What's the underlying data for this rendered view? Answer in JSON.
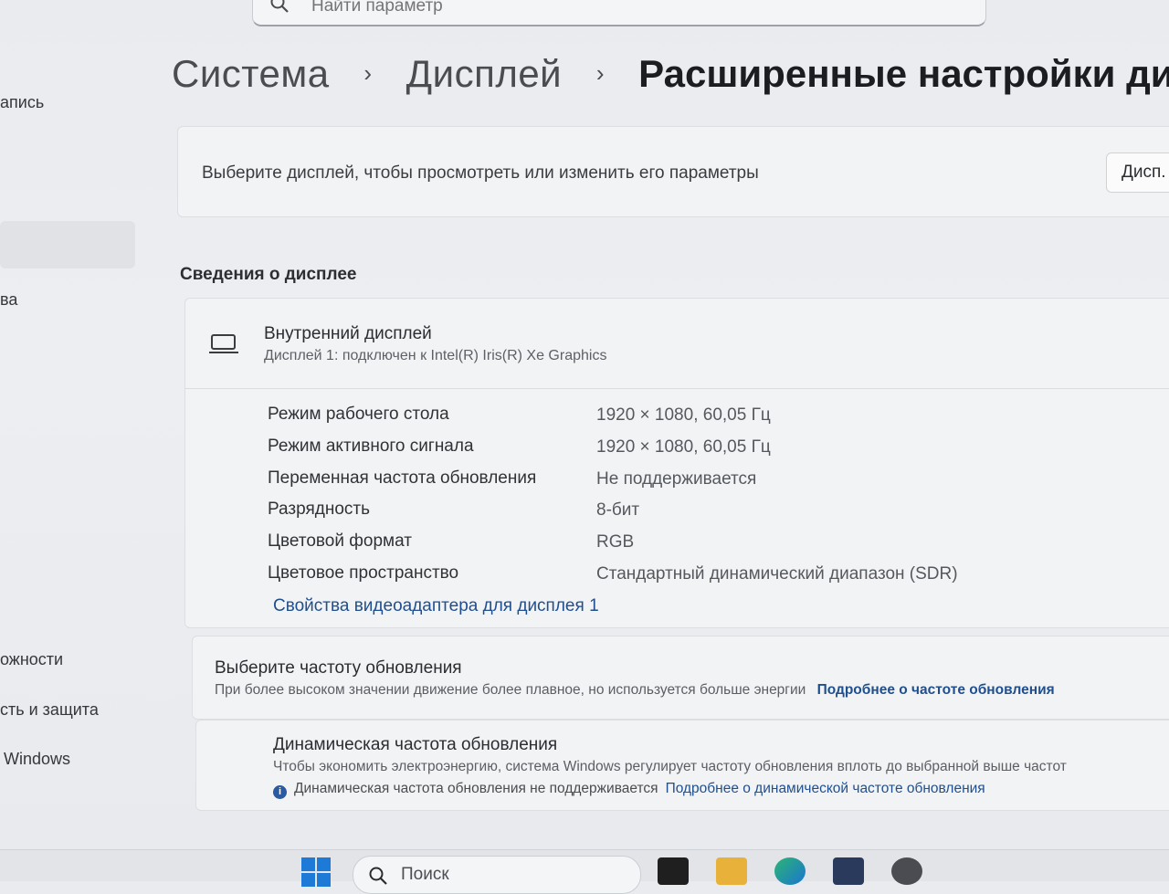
{
  "search": {
    "placeholder": "Найти параметр"
  },
  "sidebar": {
    "items": [
      {
        "label": "апись"
      },
      {
        "label": "ва"
      },
      {
        "label": "ожности"
      },
      {
        "label": "сть и защита"
      },
      {
        "label": "Windows"
      }
    ]
  },
  "breadcrumb": {
    "root": "Система",
    "parent": "Дисплей",
    "current": "Расширенные настройки дисп"
  },
  "display_select": {
    "text": "Выберите дисплей, чтобы просмотреть или изменить его параметры",
    "dropdown_value": "Дисп."
  },
  "section_title": "Сведения о дисплее",
  "display_info": {
    "title": "Внутренний дисплей",
    "subtitle": "Дисплей 1: подключен к Intel(R) Iris(R) Xe Graphics",
    "rows": [
      {
        "label": "Режим рабочего стола",
        "value": "1920 × 1080, 60,05 Гц"
      },
      {
        "label": "Режим активного сигнала",
        "value": "1920 × 1080, 60,05 Гц"
      },
      {
        "label": "Переменная частота обновления",
        "value": "Не поддерживается"
      },
      {
        "label": "Разрядность",
        "value": "8-бит"
      },
      {
        "label": "Цветовой формат",
        "value": "RGB"
      },
      {
        "label": "Цветовое пространство",
        "value": "Стандартный динамический диапазон (SDR)"
      }
    ],
    "adapter_link": "Свойства видеоадаптера для дисплея 1"
  },
  "refresh_rate": {
    "title": "Выберите частоту обновления",
    "description": "При более высоком значении движение более плавное, но используется больше энергии",
    "link": "Подробнее о частоте обновления"
  },
  "dynamic_refresh": {
    "title": "Динамическая частота обновления",
    "description": "Чтобы экономить электроэнергию, система Windows регулирует частоту обновления вплоть до выбранной выше частот",
    "note": "Динамическая частота обновления не поддерживается",
    "link": "Подробнее о динамической частоте обновления"
  },
  "taskbar": {
    "search_label": "Поиск"
  },
  "colors": {
    "accent": "#1f4f8f",
    "start": "#1d7ad6"
  }
}
